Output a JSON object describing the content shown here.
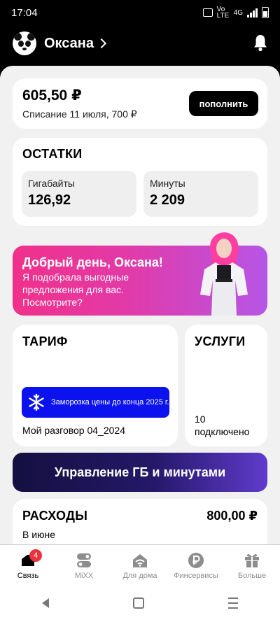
{
  "status_bar": {
    "time": "17:04",
    "network_label": "4G",
    "volte_label": "Vo LTE"
  },
  "header": {
    "user_name": "Оксана"
  },
  "balance": {
    "amount": "605,50 ₽",
    "charge_note": "Списание 11 июля, 700 ₽",
    "topup_label": "пополнить"
  },
  "remainders": {
    "title": "ОСТАТКИ",
    "gigabytes_label": "Гигабайты",
    "gigabytes_value": "126,92",
    "minutes_label": "Минуты",
    "minutes_value": "2 209"
  },
  "promo": {
    "title": "Добрый день, Оксана!",
    "text": "Я подобрала выгодные предложения для вас. Посмотрите?"
  },
  "tariff": {
    "title": "ТАРИФ",
    "freeze_text": "Заморозка цены до конца 2025 г.",
    "name": "Мой разговор 04_2024"
  },
  "services": {
    "title": "УСЛУГИ",
    "count": "10",
    "count_label": "подключено"
  },
  "manage_button": {
    "label": "Управление ГБ и минутами"
  },
  "expenses": {
    "title": "РАСХОДЫ",
    "amount": "800,00 ₽",
    "period": "В июне"
  },
  "bottom_nav": {
    "items": [
      {
        "label": "Связь",
        "icon": "sim-icon",
        "badge": "4",
        "active": true
      },
      {
        "label": "MiXX",
        "icon": "toggle-icon"
      },
      {
        "label": "Для дома",
        "icon": "home-wifi-icon"
      },
      {
        "label": "Финсервисы",
        "icon": "ruble-icon"
      },
      {
        "label": "Больше",
        "icon": "gift-icon"
      }
    ]
  },
  "colors": {
    "accent_blue": "#0b12ee",
    "promo_pink": "#f0318a",
    "badge_red": "#e8323c"
  }
}
